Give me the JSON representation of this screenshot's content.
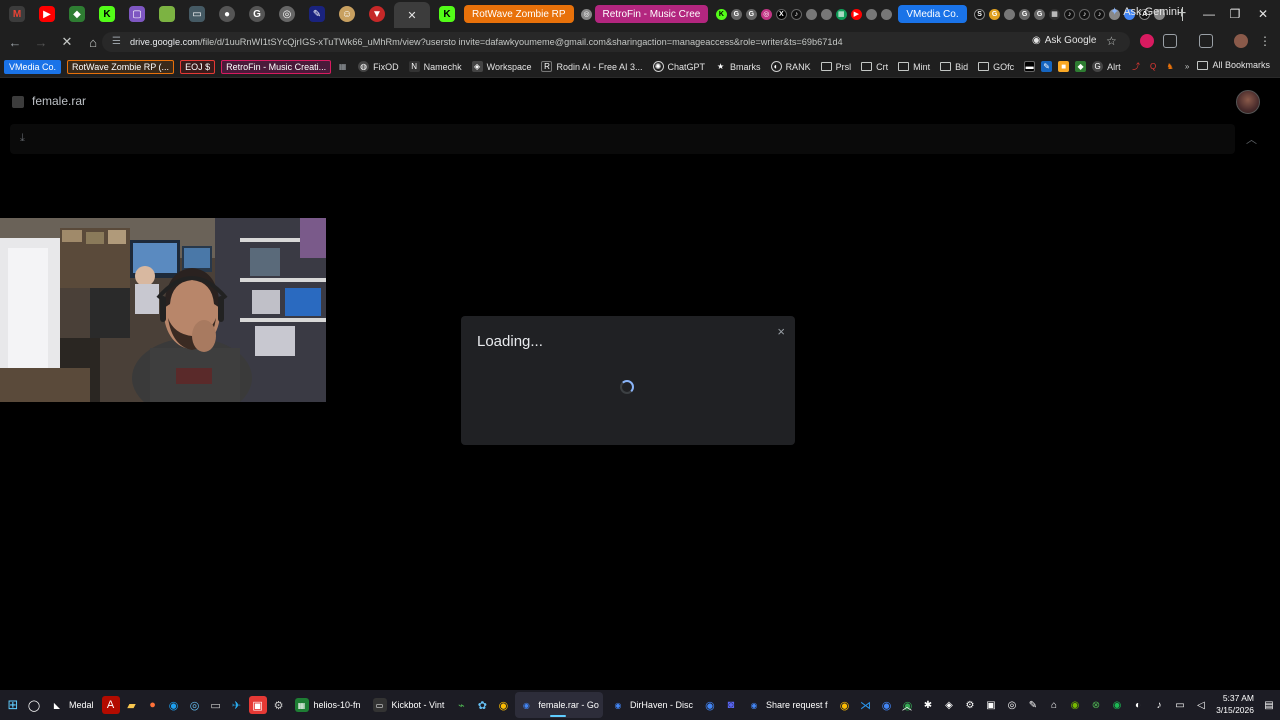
{
  "browser": {
    "tabs_named": [
      {
        "label": "RotWave Zombie RP",
        "color": "#e8710a"
      },
      {
        "label": "RetroFin - Music Cree",
        "color": "#b3267f"
      },
      {
        "label": "VMedia Co.",
        "color": "#1a73e8"
      }
    ],
    "ask_gemini": "Ask Gemini",
    "url_host": "drive.google.com",
    "url_path": "/file/d/1uuRnWI1tSYcQjrIGS-xTuTWk66_uMhRm/view?usersto invite=dafawkyoumeme@gmail.com&sharingaction=manageaccess&role=writer&ts=69b671d4",
    "ask_google": "Ask Google"
  },
  "bookmarks": {
    "chips": [
      {
        "label": "VMedia Co.",
        "color": "#1a73e8"
      },
      {
        "label": "RotWave Zombie RP (...",
        "color": "#5a3a1a"
      },
      {
        "label": "EOJ $",
        "color": "#7a1a1a"
      },
      {
        "label": "RetroFin - Music Creati...",
        "color": "#7a1a4a"
      }
    ],
    "items": [
      {
        "label": "FixOD",
        "icon": "fixod-icon",
        "color": "#444"
      },
      {
        "label": "Namechk",
        "icon": "namechk-icon",
        "color": "#333"
      },
      {
        "label": "Workspace",
        "icon": "workspace-icon",
        "color": "#444"
      },
      {
        "label": "Rodin AI - Free AI 3...",
        "icon": "rodin-icon",
        "color": "#333"
      },
      {
        "label": "ChatGPT",
        "icon": "chatgpt-icon",
        "color": "#333"
      },
      {
        "label": "Bmarks",
        "icon": "bmarks-icon",
        "color": "#333"
      },
      {
        "label": "RANK",
        "icon": "rank-icon",
        "color": "#333"
      }
    ],
    "folders": [
      "Prsl",
      "Crt",
      "Mint",
      "Bid",
      "GOfc"
    ],
    "after_folders": [
      {
        "label": "Alrt",
        "icon": "google-icon",
        "color": "#333"
      }
    ],
    "all_bookmarks": "All Bookmarks"
  },
  "viewer": {
    "file_name": "female.rar"
  },
  "dialog": {
    "title": "Loading...",
    "close_glyph": "×"
  },
  "taskbar": {
    "apps": [
      {
        "label": "Medal",
        "icon": "medal-icon",
        "color": "#222",
        "active": false
      },
      {
        "label": "helios-10-fn",
        "icon": "helios-icon",
        "color": "#1e7e34",
        "active": false
      },
      {
        "label": "Kickbot - Vint",
        "icon": "kickbot-icon",
        "color": "#333",
        "active": false
      },
      {
        "label": "female.rar - Go",
        "icon": "chrome-icon",
        "color": "#2b4a8b",
        "active": true
      },
      {
        "label": "DirHaven - Disc",
        "icon": "chrome-icon",
        "color": "#2b4a8b",
        "active": false
      },
      {
        "label": "Share request f",
        "icon": "chrome-icon",
        "color": "#2b4a8b",
        "active": false
      }
    ],
    "clock_time": "5:37 AM",
    "clock_date": "3/15/2026"
  }
}
